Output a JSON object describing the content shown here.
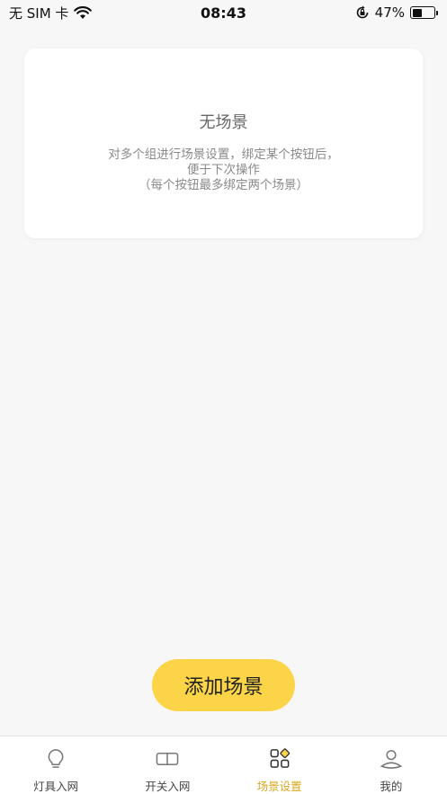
{
  "status_bar": {
    "carrier": "无 SIM 卡",
    "time": "08:43",
    "battery_percent": "47%",
    "battery_level": 0.47
  },
  "empty_state": {
    "title": "无场景",
    "desc_line1": "对多个组进行场景设置，绑定某个按钮后，",
    "desc_line2": "便于下次操作",
    "desc_line3": "（每个按钮最多绑定两个场景）"
  },
  "add_button": {
    "label": "添加场景"
  },
  "tabs": [
    {
      "label": "灯具入网",
      "icon": "lightbulb-icon"
    },
    {
      "label": "开关入网",
      "icon": "switch-icon"
    },
    {
      "label": "场景设置",
      "icon": "scene-grid-icon",
      "active": true
    },
    {
      "label": "我的",
      "icon": "user-icon"
    }
  ],
  "colors": {
    "accent": "#fbd448",
    "active_tab": "#d9a722",
    "background": "#f7f7f7"
  }
}
